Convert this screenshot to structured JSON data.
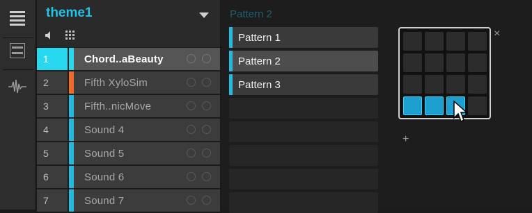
{
  "group": {
    "name": "theme1"
  },
  "sounds": [
    {
      "number": "1",
      "name": "Chord..aBeauty",
      "color": "#27d8ee",
      "selected": true
    },
    {
      "number": "2",
      "name": "Fifth XyloSim",
      "color": "#f06a2a",
      "selected": false
    },
    {
      "number": "3",
      "name": "Fifth..nicMove",
      "color": "#25b9e0",
      "selected": false
    },
    {
      "number": "4",
      "name": "Sound 4",
      "color": "#25b9e0",
      "selected": false
    },
    {
      "number": "5",
      "name": "Sound 5",
      "color": "#25b9e0",
      "selected": false
    },
    {
      "number": "6",
      "name": "Sound 6",
      "color": "#25b9e0",
      "selected": false
    },
    {
      "number": "7",
      "name": "Sound 7",
      "color": "#25b9e0",
      "selected": false
    }
  ],
  "patterns": {
    "header_ghost": "Pattern 2",
    "items": [
      "Pattern 1",
      "Pattern 2",
      "Pattern 3"
    ],
    "selected_index": 1,
    "add_label": "+"
  },
  "popup": {
    "close_label": "×",
    "active_pads": [
      12,
      13,
      14
    ],
    "accent_color": "#1d9fcf"
  },
  "icons": [
    "list-icon",
    "mixer-icon",
    "waveform-icon",
    "speaker-icon",
    "grid-icon",
    "dropdown-arrow-icon",
    "knob-icon",
    "close-icon",
    "cursor-icon"
  ]
}
